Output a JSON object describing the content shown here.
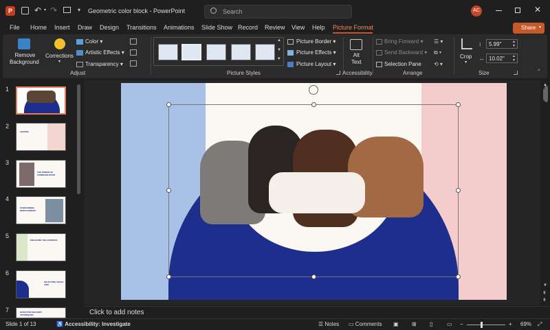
{
  "app": {
    "logo_letter": "P",
    "title": "Geometric color block  -  PowerPoint",
    "avatar": "AC"
  },
  "search": {
    "placeholder": "Search"
  },
  "menu": {
    "tabs": [
      "File",
      "Home",
      "Insert",
      "Draw",
      "Design",
      "Transitions",
      "Animations",
      "Slide Show",
      "Record",
      "Review",
      "View",
      "Help",
      "Picture Format"
    ],
    "active": "Picture Format",
    "share": "Share"
  },
  "ribbon": {
    "adjust": {
      "remove_bg_1": "Remove",
      "remove_bg_2": "Background",
      "corrections": "Corrections",
      "color": "Color",
      "artistic": "Artistic Effects",
      "transparency": "Transparency",
      "label": "Adjust"
    },
    "styles": {
      "label": "Picture Styles",
      "border": "Picture Border",
      "effects": "Picture Effects",
      "layout": "Picture Layout"
    },
    "accessibility": {
      "alt1": "Alt",
      "alt2": "Text",
      "label": "Accessibility"
    },
    "arrange": {
      "bring_forward": "Bring Forward",
      "send_backward": "Send Backward",
      "selection_pane": "Selection Pane",
      "label": "Arrange"
    },
    "size": {
      "crop": "Crop",
      "height": "5.99\"",
      "width": "10.02\"",
      "label": "Size"
    }
  },
  "thumbnails": [
    {
      "num": "1",
      "title": ""
    },
    {
      "num": "2",
      "title": "AGENDA"
    },
    {
      "num": "3",
      "title": "THE POWER OF COMMUNICATION"
    },
    {
      "num": "4",
      "title": "OVERCOMING NERVOUSNESS"
    },
    {
      "num": "5",
      "title": "ENGAGING THE AUDIENCE"
    },
    {
      "num": "6",
      "title": "SELECTING VISUAL AIDS"
    },
    {
      "num": "7",
      "title": "EFFECTIVE DELIVERY TECHNIQUES"
    }
  ],
  "notes": {
    "placeholder": "Click to add notes"
  },
  "status": {
    "slide": "Slide 1 of 13",
    "accessibility": "Accessibility: Investigate",
    "notes": "Notes",
    "comments": "Comments",
    "zoom": "69%"
  },
  "colors": {
    "accent": "#c55a28",
    "slide_blue": "#1e2e8c",
    "slide_lightblue": "#a9c1e6",
    "slide_pink": "#f4cccc",
    "slide_cream": "#fbf7f2"
  }
}
